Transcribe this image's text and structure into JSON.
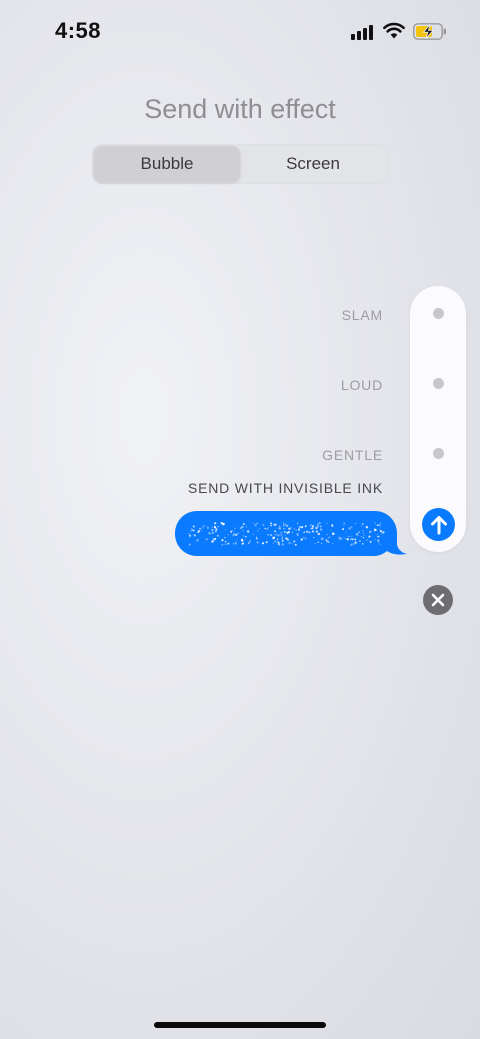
{
  "status_bar": {
    "time": "4:58"
  },
  "header": {
    "title": "Send with effect"
  },
  "tabs": [
    {
      "label": "Bubble",
      "selected": true
    },
    {
      "label": "Screen",
      "selected": false
    }
  ],
  "effects": [
    {
      "label": "SLAM",
      "selected": false
    },
    {
      "label": "LOUD",
      "selected": false
    },
    {
      "label": "GENTLE",
      "selected": false
    },
    {
      "label": "SEND WITH INVISIBLE INK",
      "selected": true
    }
  ],
  "colors": {
    "accent": "#0a7aff",
    "label_inactive": "#9c9ca1",
    "label_active": "#48484c"
  },
  "icons": {
    "send": "arrow-up-icon",
    "close": "x-icon"
  }
}
